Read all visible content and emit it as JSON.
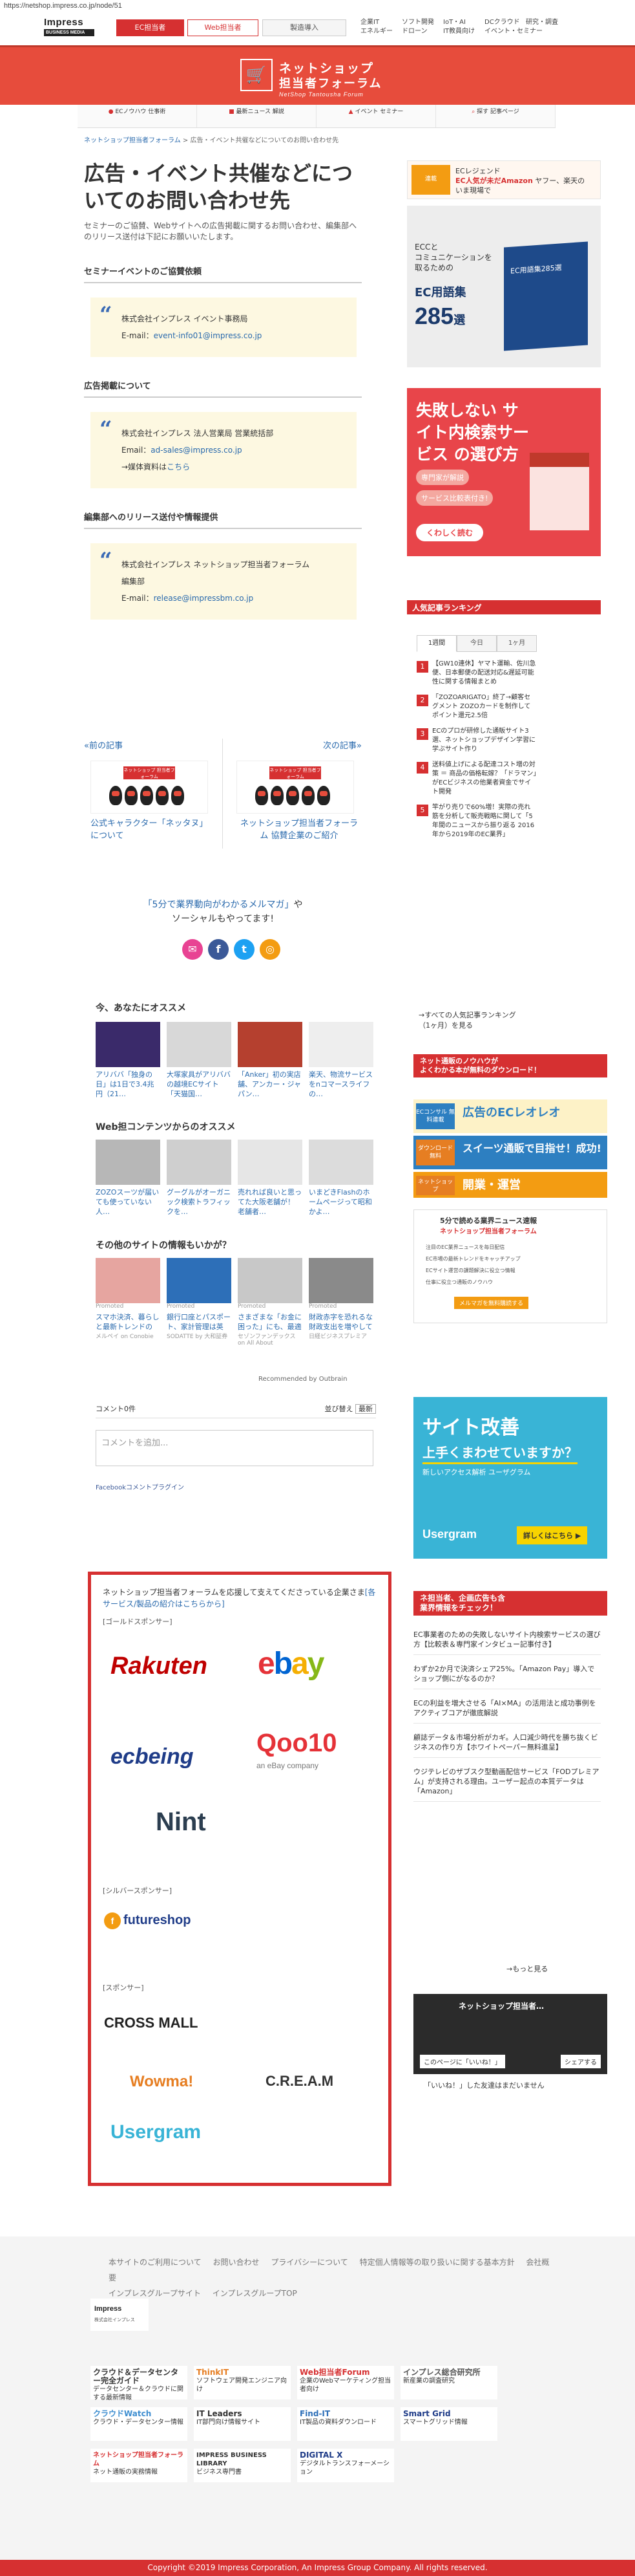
{
  "url": "https://netshop.impress.co.jp/node/51",
  "topnav": {
    "impress_logo": "Impress",
    "impress_sub": "BUSINESS MEDIA",
    "tab_ec": "EC担当者",
    "tab_adv": "Web担当者",
    "tab_prod": "製造導入",
    "site_links": [
      "企業IT",
      "ソフト開発",
      "IoT・AI",
      "DCクラウド",
      "研究・調査",
      "エネルギー",
      "ドローン",
      "IT教員向け",
      "イベント・セミナー"
    ]
  },
  "brand": {
    "title1": "ネットショップ",
    "title2": "担当者フォーラム",
    "sub": "NetShop Tantousha Forum"
  },
  "catbar": [
    "ECノウハウ 仕事術",
    "最新ニュース 解説",
    "イベント セミナー",
    "探す 記事ページ"
  ],
  "breadcrumb": {
    "home": "ネットショップ担当者フォーラム",
    "sep": " > ",
    "current": "広告・イベント共催などについてのお問い合わせ先"
  },
  "main": {
    "title": "広告・イベント共催などについてのお問い合わせ先",
    "lead": "セミナーのご協賛、Webサイトへの広告掲載に関するお問い合わせ、編集部へのリリース送付は下記にお願いいたします。",
    "sections": [
      {
        "heading": "セミナーイベントのご協賛依頼",
        "org": "株式会社インプレス イベント事務局",
        "email_label": "E-mail：",
        "email": "event-info01@impress.co.jp"
      },
      {
        "heading": "広告掲載について",
        "org": "株式会社インプレス 法人営業局 営業統括部",
        "email_label": "Email：",
        "email": "ad-sales@impress.co.jp",
        "media_text": "→媒体資料は",
        "media_link": "こちら"
      },
      {
        "heading": "編集部へのリリース送付や情報提供",
        "org": "株式会社インプレス ネットショップ担当者フォーラム",
        "dept": "編集部",
        "email_label": "E-mail：",
        "email": "release@impressbm.co.jp"
      }
    ]
  },
  "prevnext": {
    "prev_label": "«前の記事",
    "next_label": "次の記事»",
    "prev_caption": "公式キャラクター「ネッタヌ」について",
    "next_caption": "ネットショップ担当者フォーラム 協賛企業のご紹介",
    "logo_text": "ネットショップ 担当者フォーラム"
  },
  "mailmag": {
    "link": "「5分で業界動向がわかるメルマガ」",
    "text1": "や",
    "text2": "ソーシャルもやってます!"
  },
  "social": [
    "✉",
    "f",
    "t",
    "◎"
  ],
  "rec1": {
    "heading": "今、あなたにオススメ",
    "items": [
      {
        "cap": "アリババ「独身の日」は1日で3.4兆円（21…",
        "color": "#3a2a6a"
      },
      {
        "cap": "大塚家具がアリババの越境ECサイト「天猫国…",
        "color": "#d8d8d8"
      },
      {
        "cap": "「Anker」初の実店舗、アンカー・ジャパン…",
        "color": "#b5402f"
      },
      {
        "cap": "楽天、物流サービスをnコマースライフの…",
        "color": "#eeeeee"
      }
    ]
  },
  "rec2": {
    "heading": "Web担コンテンツからのオススメ",
    "items": [
      {
        "cap": "ZOZOスーツが届いても使っていない人…",
        "color": "#b7b7b7"
      },
      {
        "cap": "グーグルがオーガニック検索トラフィックを…",
        "color": "#cfcfcf"
      },
      {
        "cap": "売れれば良いと思ってた大阪老舗が！ 老舗者…",
        "color": "#e6e6e6"
      },
      {
        "cap": "いまどきFlashのホームページって昭和かよ…",
        "color": "#dcdcdc"
      }
    ]
  },
  "rec3": {
    "heading": "その他のサイトの情報もいかが？",
    "promoted": "Promoted",
    "items": [
      {
        "cap": "スマホ決済、暮らしと最新トレンドの「メルペイ…",
        "src": "メルペイ on Conobie",
        "color": "#e6a5a0"
      },
      {
        "cap": "銀行口座とパスポート、家計管理は英語……",
        "src": "SODATTE by 大和証券",
        "color": "#2d6fb8"
      },
      {
        "cap": "さまざまな「お金に困った」にも、最適な融…",
        "src": "セゾンファンデックス on All About",
        "color": "#c8c8c8"
      },
      {
        "cap": "財政赤字を恐れるな 財政支出を増やしてもい…",
        "src": "日経ビジネスプレミア",
        "color": "#8a8a8a"
      }
    ]
  },
  "outbrain": "Recommended by Outbrain",
  "comments": {
    "count": "コメント0件",
    "sort_label": "並び替え",
    "sort_value": "最新",
    "placeholder": "コメントを追加...",
    "fb_plugin": "Facebookコメントプラグイン"
  },
  "sponsors": {
    "intro": "ネットショップ担当者フォーラムを応援して支えてくださっている企業さま",
    "intro_link": "[各サービス/製品の紹介はこちらから]",
    "gold_label": "[ゴールドスポンサー]",
    "silver_label": "[シルバースポンサー]",
    "sponsor_label": "[スポンサー]",
    "gold": [
      "Rakuten",
      "ebay",
      "ecbeing",
      "Qoo10",
      "an eBay company",
      "Nint"
    ],
    "silver": [
      "futureshop"
    ],
    "sponsor": [
      "CROSS MALL",
      "Wowma!",
      "C.R.E.A.M",
      "Usergram"
    ]
  },
  "sidebar": {
    "ad1_line1": "ECレジェンド",
    "ad1_line2": "EC人気が未だAmazon",
    "ad1_line3": "ヤフー、楽天の",
    "ad1_line4": "いま現場で",
    "ad1_badge": "連載",
    "ad2_copy1": "ECCと",
    "ad2_copy2": "コミュニケーションを",
    "ad2_copy3": "取るための",
    "ad2_big": "EC用語集",
    "ad2_num": "285",
    "ad2_unit": "選",
    "ad2_book": "EC用語集285選",
    "ad3_title": "失敗しない サイト内検索サービス の選び方",
    "ad3_b1": "専門家が解説",
    "ad3_b2": "サービス比較表付き!",
    "ad3_b3": "くわしく読む",
    "ranking_title": "人気記事ランキング",
    "ranking_tabs": [
      "1週間",
      "今日",
      "1ヶ月"
    ],
    "ranking": [
      "【GW10連休】ヤマト運輸、佐川急便、日本郵便の配送対応&遅延可能性に関する情報まとめ",
      "「ZOZOARIGATO」終了→顧客セグメント ZOZOカードを制作してポイント還元2.5倍",
      "ECのプロが研修した通販サイト3選、ネットショップデザイン学習に学ぶサイト作り",
      "送料値上げによる配達コスト増の対策 ＝ 商品の価格転嫁？「ドラマン」がECビジネスの他業者資金でサイト開発",
      "竿がり売りで60%増！実際の売れ筋を分析して販売戦略に関して「5年間のニュースから振り返る 2016年から2019年のEC業界」"
    ],
    "ranking_more1": "→すべての人気記事ランキング",
    "ranking_more2": "（1ヶ月）を見る",
    "know_title1": "ネット通販のノウハウが",
    "know_title2": "よくわかる本が無料のダウンロード！",
    "kb": [
      {
        "left": "ECコンサル 無料連載",
        "right": "広告のECレオレオ",
        "color": "#2d7fc1",
        "rc": "#2d7fc1"
      },
      {
        "left": "ダウンロード 無料",
        "right": "スイーツ通販で目指せ！成功!",
        "color": "#e67e22",
        "rc": "#fff"
      },
      {
        "left": "ネットショップ",
        "right": "開業・運営",
        "color": "#f39c12",
        "rc": "#fff"
      }
    ],
    "ad4_title": "5分で読める業界ニュース速報",
    "ad4_title2": "ネットショップ担当者フォーラム",
    "ad4_lines": [
      "注目のEC業界ニュースを毎日配信",
      "EC市場の最新トレンドをキャッチアップ",
      "ECサイト運営の課題解決に役立つ情報",
      "仕事に役立つ通販のノウハウ"
    ],
    "ad4_btn": "メルマガを無料購読する",
    "ad5_h": "サイト改善",
    "ad5_h2": "上手くまわせていますか？",
    "ad5_s": "新しいアクセス解析 ユーザグラム",
    "ad5_logo": "Usergram",
    "ad5_btn": "詳しくはこちら ▶",
    "news_title1": "ネ担当者、企画広告も含",
    "news_title2": "業界情報をチェック！",
    "news": [
      "EC事業者のための失敗しないサイト内検索サービスの選び方【比較表＆専門家インタビュー記事付き】",
      "わずか2か月で決済シェア25%。「Amazon Pay」導入でショップ側にがなるのか？",
      "ECの利益を増大させる「AI×MA」の活用法と成功事例をアクティブコアが徹底解説",
      "顧誌データ＆市場分析がカギ。人口減少時代を勝ち抜くビジネスの作り方【ホワイトペーパー無料進呈】",
      "ウジテレビのザブスク型動画配信サービス「FODプレミアム」が支持される理由。ユーザー起点の本質データは「Amazon」"
    ],
    "news_more": "→もっと見る",
    "fb_title": "ネットショップ担当者…",
    "fb_like": "このページに「いいね！」",
    "fb_share": "シェアする",
    "fb_note": "「いいね！」した友達はまだいません"
  },
  "footer": {
    "links": [
      "本サイトのご利用について",
      "お問い合わせ",
      "プライバシーについて",
      "特定個人情報等の取り扱いに関する基本方針",
      "会社概要",
      "インプレスグループサイト",
      "インプレスグループTOP"
    ],
    "logo": "Impress",
    "logo_sub": "株式会社インプレス",
    "grid": [
      {
        "name": "クラウド＆データセンター完全ガイド",
        "desc": "データセンター＆クラウドに関する最新情報",
        "color": "#333333"
      },
      {
        "name": "ThinkIT",
        "desc": "ソフトウェア開発エンジニア向け",
        "color": "#e67e22"
      },
      {
        "name": "Web担当者Forum",
        "desc": "企業のWebマーケティング担当者向け",
        "color": "#d63031"
      },
      {
        "name": "インプレス総合研究所",
        "desc": "新産業の調査研究",
        "color": "#555555"
      },
      {
        "name": "クラウドWatch",
        "desc": "クラウド・データセンター情報",
        "color": "#3e8ed0"
      },
      {
        "name": "IT Leaders",
        "desc": "IT部門向け情報サイト",
        "color": "#333333"
      },
      {
        "name": "Find-IT",
        "desc": "IT製品の資料ダウンロード",
        "color": "#2d6fb8"
      },
      {
        "name": "Smart Grid",
        "desc": "スマートグリッド情報",
        "color": "#1f3c88"
      },
      {
        "name": "ネットショップ担当者フォーラム",
        "desc": "ネット通販の実務情報",
        "color": "#d63031"
      },
      {
        "name": "IMPRESS BUSINESS LIBRARY",
        "desc": "ビジネス専門書",
        "color": "#333333"
      },
      {
        "name": "DIGITAL X",
        "desc": "デジタルトランスフォーメーション",
        "color": "#1f3c88"
      }
    ],
    "copyright": "Copyright ©2019 Impress Corporation, An Impress Group Company. All rights reserved."
  }
}
